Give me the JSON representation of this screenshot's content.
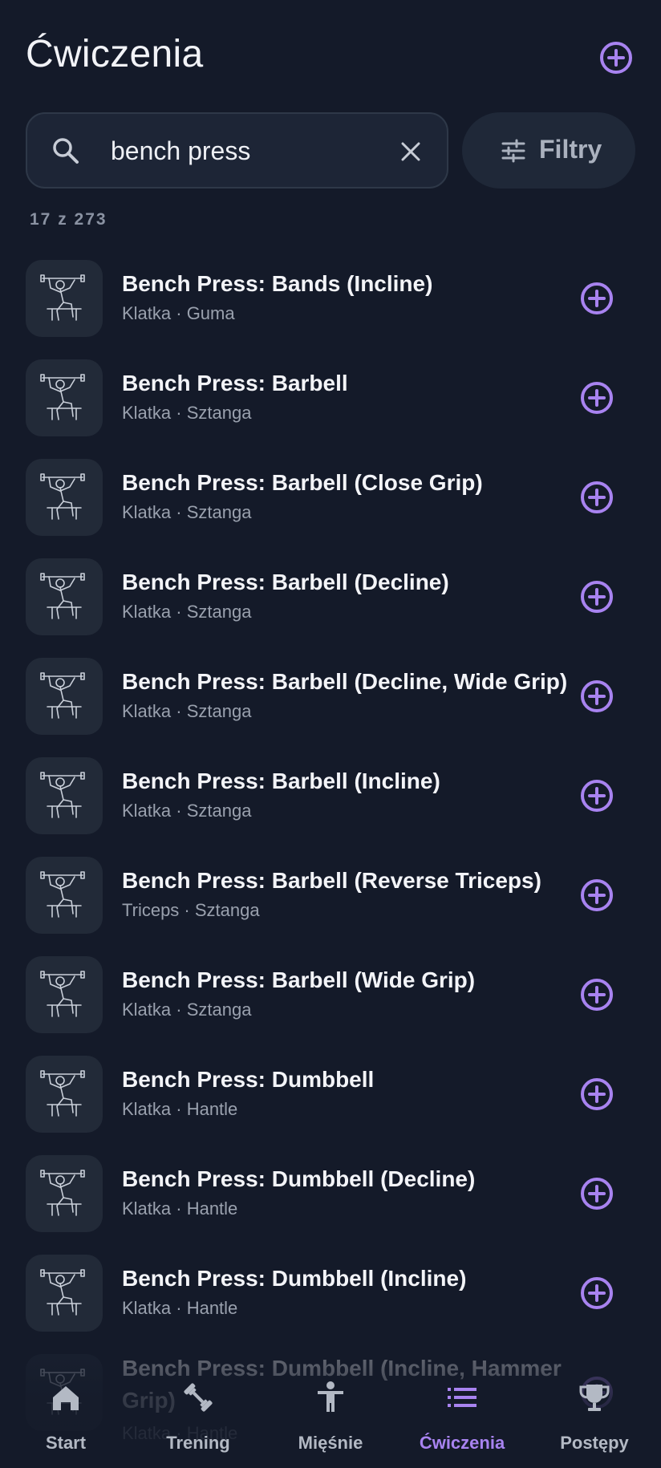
{
  "header": {
    "title": "Ćwiczenia"
  },
  "search": {
    "value": "bench press"
  },
  "filter": {
    "label": "Filtry"
  },
  "result_count": "17 z 273",
  "colors": {
    "accent": "#a883f0",
    "background": "#141a29",
    "surface": "#1d2536"
  },
  "exercises": [
    {
      "name": "Bench Press: Bands (Incline)",
      "meta": "Klatka · Guma"
    },
    {
      "name": "Bench Press: Barbell",
      "meta": "Klatka · Sztanga"
    },
    {
      "name": "Bench Press: Barbell (Close Grip)",
      "meta": "Klatka · Sztanga"
    },
    {
      "name": "Bench Press: Barbell (Decline)",
      "meta": "Klatka · Sztanga"
    },
    {
      "name": "Bench Press: Barbell (Decline, Wide Grip)",
      "meta": "Klatka · Sztanga"
    },
    {
      "name": "Bench Press: Barbell (Incline)",
      "meta": "Klatka · Sztanga"
    },
    {
      "name": "Bench Press: Barbell (Reverse Triceps)",
      "meta": "Triceps · Sztanga"
    },
    {
      "name": "Bench Press: Barbell (Wide Grip)",
      "meta": "Klatka · Sztanga"
    },
    {
      "name": "Bench Press: Dumbbell",
      "meta": "Klatka · Hantle"
    },
    {
      "name": "Bench Press: Dumbbell (Decline)",
      "meta": "Klatka · Hantle"
    },
    {
      "name": "Bench Press: Dumbbell (Incline)",
      "meta": "Klatka · Hantle"
    },
    {
      "name": "Bench Press: Dumbbell (Incline, Hammer Grip)",
      "meta": "Klatka · Hantle"
    }
  ],
  "nav": [
    {
      "label": "Start",
      "icon": "home-icon"
    },
    {
      "label": "Trening",
      "icon": "dumbbell-icon"
    },
    {
      "label": "Mięśnie",
      "icon": "body-icon"
    },
    {
      "label": "Ćwiczenia",
      "icon": "list-icon",
      "active": true
    },
    {
      "label": "Postępy",
      "icon": "trophy-icon"
    }
  ]
}
